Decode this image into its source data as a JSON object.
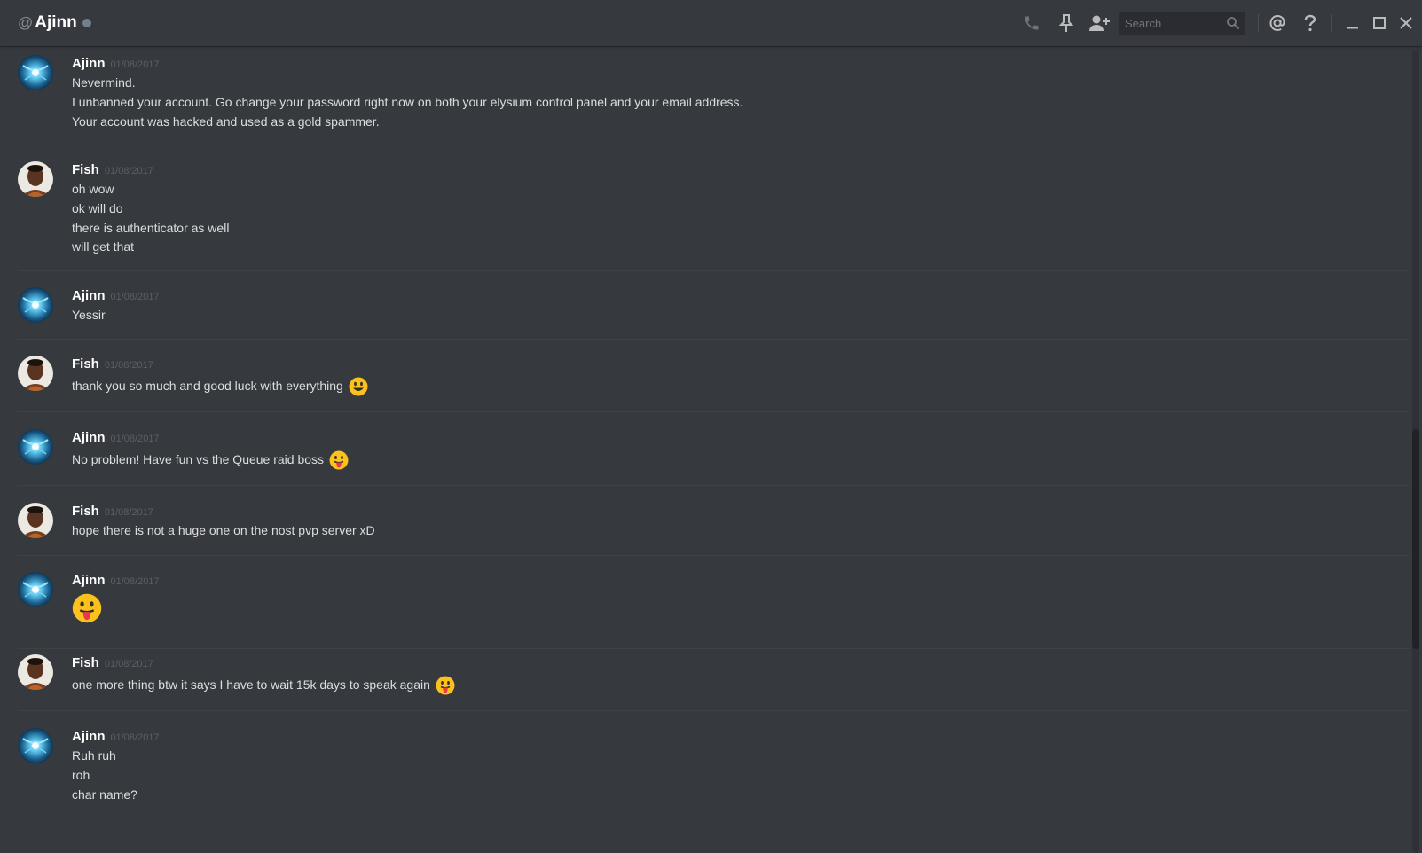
{
  "header": {
    "at_symbol": "@",
    "dm_name": "Ajinn",
    "status_color": "#747f8d",
    "icons": [
      "phone-icon",
      "pin-icon",
      "add-friend-icon",
      "mention-icon",
      "help-icon",
      "minimize-icon",
      "maximize-icon",
      "close-icon"
    ],
    "search_placeholder": "Search"
  },
  "colors": {
    "background": "#36393e",
    "username": "#ffffff",
    "timestamp": "#5c5f65",
    "message_text": "#dcddde"
  },
  "messages": [
    {
      "author": "Ajinn",
      "timestamp": "01/08/2017",
      "avatar": "ajinn-avatar",
      "lines": [
        "Nevermind.",
        "I unbanned your account. Go change your password right now on both your elysium control panel and your email address.",
        "Your account was hacked and used as a gold spammer."
      ]
    },
    {
      "author": "Fish",
      "timestamp": "01/08/2017",
      "avatar": "fish-avatar",
      "lines": [
        "oh wow",
        "ok will do",
        "there is authenticator as well",
        "will get that"
      ]
    },
    {
      "author": "Ajinn",
      "timestamp": "01/08/2017",
      "avatar": "ajinn-avatar",
      "lines": [
        "Yessir"
      ]
    },
    {
      "author": "Fish",
      "timestamp": "01/08/2017",
      "avatar": "fish-avatar",
      "lines": [
        "thank you so much and good luck with everything"
      ],
      "emoji": "smiley-emoji"
    },
    {
      "author": "Ajinn",
      "timestamp": "01/08/2017",
      "avatar": "ajinn-avatar",
      "lines": [
        "No problem! Have fun vs the Queue raid boss"
      ],
      "emoji": "tongue-emoji"
    },
    {
      "author": "Fish",
      "timestamp": "01/08/2017",
      "avatar": "fish-avatar",
      "lines": [
        "hope there is not a huge one on the nost pvp server xD"
      ]
    },
    {
      "author": "Ajinn",
      "timestamp": "01/08/2017",
      "avatar": "ajinn-avatar",
      "lines": [],
      "emoji": "tongue-emoji-large"
    },
    {
      "author": "Fish",
      "timestamp": "01/08/2017",
      "avatar": "fish-avatar",
      "lines": [
        "one more thing btw it says I have to wait 15k days to speak again"
      ],
      "emoji": "tongue-emoji"
    },
    {
      "author": "Ajinn",
      "timestamp": "01/08/2017",
      "avatar": "ajinn-avatar",
      "lines": [
        "Ruh ruh",
        "roh",
        "char name?"
      ]
    }
  ]
}
